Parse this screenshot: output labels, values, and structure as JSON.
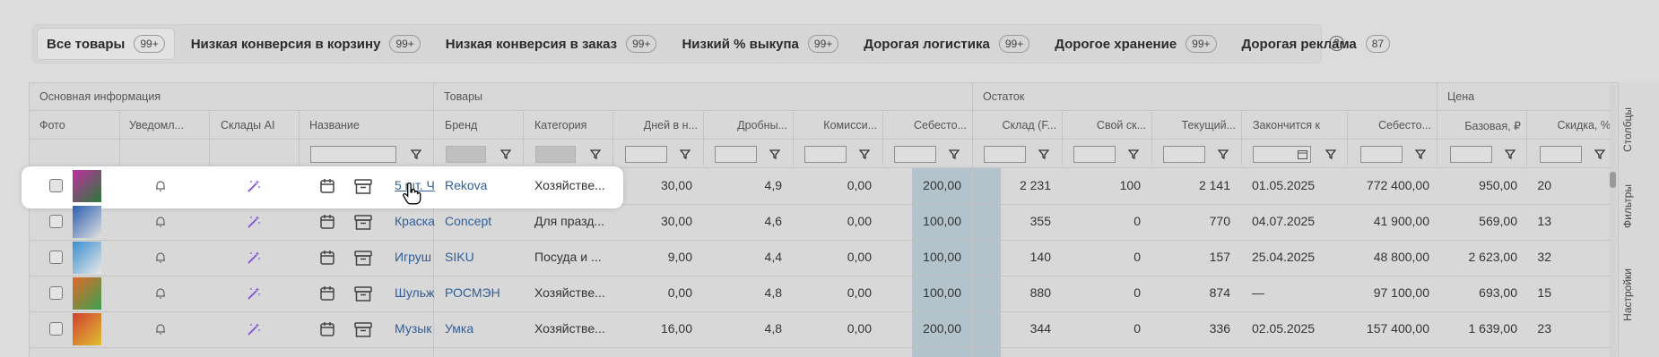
{
  "tabs": [
    {
      "label": "Все товары",
      "badge": "99+",
      "active": true
    },
    {
      "label": "Низкая конверсия в корзину",
      "badge": "99+",
      "active": false
    },
    {
      "label": "Низкая конверсия в заказ",
      "badge": "99+",
      "active": false
    },
    {
      "label": "Низкий % выкупа",
      "badge": "99+",
      "active": false
    },
    {
      "label": "Дорогая логистика",
      "badge": "99+",
      "active": false
    },
    {
      "label": "Дорогое хранение",
      "badge": "99+",
      "active": false
    },
    {
      "label": "Дорогая реклама",
      "badge": "87",
      "active": false
    }
  ],
  "help_icon": "?",
  "groups": {
    "basic": "Основная информация",
    "goods": "Товары",
    "stock": "Остаток",
    "price": "Цена"
  },
  "columns": {
    "photo": "Фото",
    "notify": "Уведомл...",
    "ai": "Склады AI",
    "name": "Название",
    "brand": "Бренд",
    "category": "Категория",
    "days": "Дней в н...",
    "fraction": "Дробны...",
    "commission": "Комисси...",
    "cost": "Себесто...",
    "warehouse": "Склад (F...",
    "own": "Свой ск...",
    "current": "Текущий...",
    "ends": "Закончится к",
    "cost2": "Себесто...",
    "base": "Базовая, ₽",
    "discount": "Скидка, %"
  },
  "rows": [
    {
      "name": "5 шт. Ч",
      "brand": "Rekova",
      "category": "Хозяйстве...",
      "days": "30,00",
      "fraction": "4,9",
      "commission": "0,00",
      "cost": "200,00",
      "warehouse": "2 231",
      "own": "100",
      "current": "2 141",
      "ends": "01.05.2025",
      "cost2": "772 400,00",
      "base": "950,00",
      "discount": "20"
    },
    {
      "name": "Краска",
      "brand": "Concept",
      "category": "Для празд...",
      "days": "30,00",
      "fraction": "4,6",
      "commission": "0,00",
      "cost": "100,00",
      "warehouse": "355",
      "own": "0",
      "current": "770",
      "ends": "04.07.2025",
      "cost2": "41 900,00",
      "base": "569,00",
      "discount": "13"
    },
    {
      "name": "Игруш",
      "brand": "SIKU",
      "category": "Посуда и ...",
      "days": "9,00",
      "fraction": "4,4",
      "commission": "0,00",
      "cost": "100,00",
      "warehouse": "140",
      "own": "0",
      "current": "157",
      "ends": "25.04.2025",
      "cost2": "48 800,00",
      "base": "2 623,00",
      "discount": "32"
    },
    {
      "name": "Шульж",
      "brand": "РОСМЭН",
      "category": "Хозяйстве...",
      "days": "0,00",
      "fraction": "4,8",
      "commission": "0,00",
      "cost": "100,00",
      "warehouse": "880",
      "own": "0",
      "current": "874",
      "ends": "—",
      "cost2": "97 100,00",
      "base": "693,00",
      "discount": "15"
    },
    {
      "name": "Музык",
      "brand": "Умка",
      "category": "Хозяйстве...",
      "days": "16,00",
      "fraction": "4,8",
      "commission": "0,00",
      "cost": "200,00",
      "warehouse": "344",
      "own": "0",
      "current": "336",
      "ends": "02.05.2025",
      "cost2": "157 400,00",
      "base": "1 639,00",
      "discount": "23"
    }
  ],
  "side_tabs": [
    "Столбцы",
    "Фильтры",
    "Настройки"
  ],
  "colors": {
    "link": "#2f5f9a",
    "ai_icon": "#7b4fd0",
    "cost_highlight": "#b3c3cc"
  }
}
